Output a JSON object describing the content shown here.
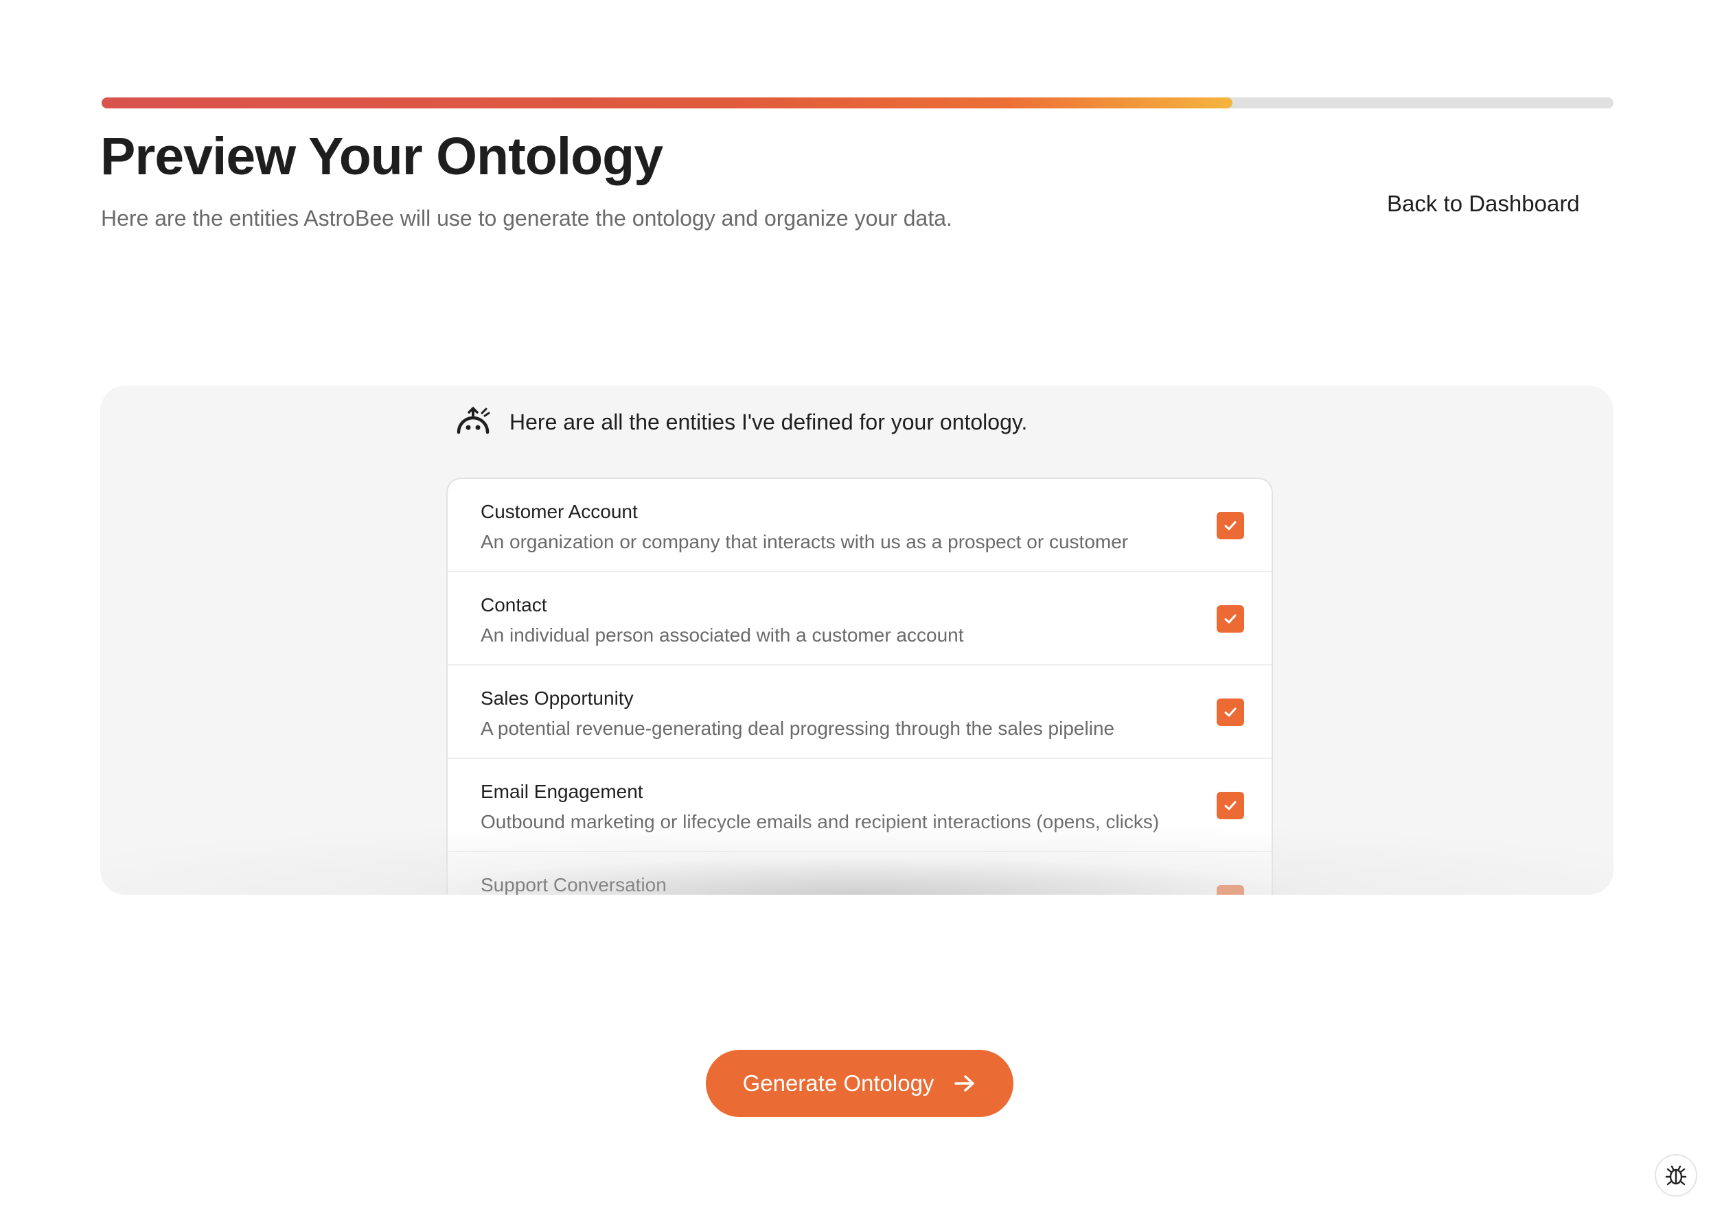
{
  "progress": {
    "value_percent": 74.8,
    "gradient_colors": [
      "#d9534f",
      "#ec6f36",
      "#f5b53f"
    ],
    "track_color": "#e0e0e0"
  },
  "header": {
    "title": "Preview Your Ontology",
    "subtitle": "Here are the entities AstroBee will use to generate the ontology and organize your data.",
    "back_link": "Back to Dashboard"
  },
  "assistant": {
    "icon": "astrobee-icon",
    "message": "Here are all the entities I've defined for your ontology."
  },
  "entities": [
    {
      "name": "Customer Account",
      "description": "An organization or company that interacts with us as a prospect or customer",
      "checked": true
    },
    {
      "name": "Contact",
      "description": "An individual person associated with a customer account",
      "checked": true
    },
    {
      "name": "Sales Opportunity",
      "description": "A potential revenue-generating deal progressing through the sales pipeline",
      "checked": true
    },
    {
      "name": "Email Engagement",
      "description": "Outbound marketing or lifecycle emails and recipient interactions (opens, clicks)",
      "checked": true
    },
    {
      "name": "Support Conversation",
      "description": "",
      "checked": true
    }
  ],
  "actions": {
    "generate_label": "Generate Ontology",
    "generate_icon": "arrow-right-icon",
    "debug_icon": "bug-icon"
  },
  "colors": {
    "accent": "#ea6b33",
    "checkbox": "#ec6b34",
    "panel_bg": "#f5f5f5"
  }
}
